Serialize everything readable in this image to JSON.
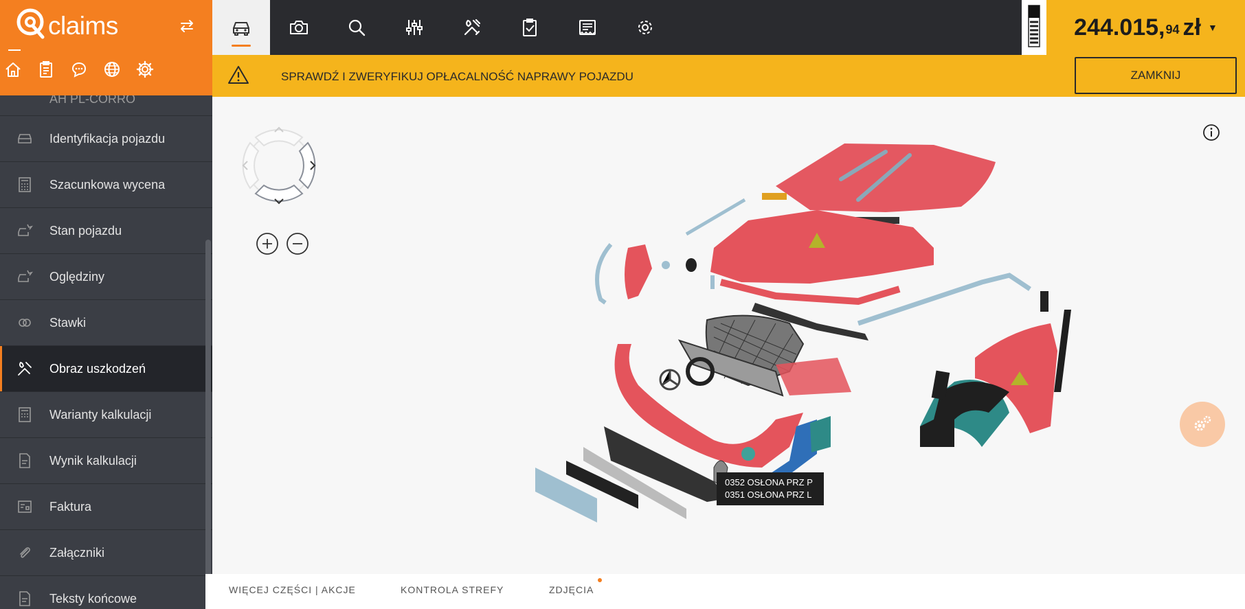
{
  "brand": {
    "logo_text": "claims"
  },
  "top_tabs": [
    {
      "icon": "car-icon",
      "active": true
    },
    {
      "icon": "camera-icon"
    },
    {
      "icon": "search-icon"
    },
    {
      "icon": "sliders-icon"
    },
    {
      "icon": "tools-icon"
    },
    {
      "icon": "clipboard-check-icon"
    },
    {
      "icon": "receipt-icon"
    },
    {
      "icon": "gear-icon"
    }
  ],
  "total": {
    "main": "244.015,",
    "cents": "94",
    "currency": "zł"
  },
  "alert": {
    "text": "SPRAWDŹ I ZWERYFIKUJ OPŁACALNOŚĆ NAPRAWY POJAZDU",
    "button": "ZAMKNIJ"
  },
  "sidebar": {
    "partial_item": "AH PL-CORRO",
    "items": [
      {
        "label": "Identyfikacja pojazdu",
        "icon": "car-icon"
      },
      {
        "label": "Szacunkowa wycena",
        "icon": "calculator-icon"
      },
      {
        "label": "Stan pojazdu",
        "icon": "damaged-car-icon"
      },
      {
        "label": "Oględziny",
        "icon": "inspection-icon"
      },
      {
        "label": "Stawki",
        "icon": "rates-icon"
      },
      {
        "label": "Obraz uszkodzeń",
        "icon": "tools-icon",
        "active": true
      },
      {
        "label": "Warianty kalkulacji",
        "icon": "calculator-icon"
      },
      {
        "label": "Wynik kalkulacji",
        "icon": "document-icon"
      },
      {
        "label": "Faktura",
        "icon": "invoice-icon"
      },
      {
        "label": "Załączniki",
        "icon": "paperclip-icon"
      },
      {
        "label": "Teksty końcowe",
        "icon": "document-icon"
      }
    ]
  },
  "tooltip": {
    "line1": "0352 OSŁONA PRZ P",
    "line2": "0351 OSŁONA PRZ L"
  },
  "bottom_tabs": [
    "WIĘCEJ CZĘŚCI | AKCJE",
    "KONTROLA STREFY",
    "ZDJĘCIA"
  ],
  "colors": {
    "brand_orange": "#f47f20",
    "alert_yellow": "#f5b41c",
    "sidebar_bg": "#3b3e45",
    "topbar_bg": "#2a2b2f",
    "part_red": "#e0505a",
    "part_blue": "#9fbfd0"
  }
}
